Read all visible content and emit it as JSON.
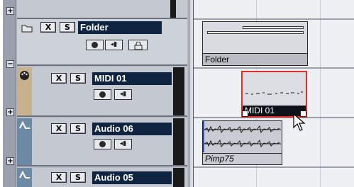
{
  "tracks": [
    {
      "type": "folder",
      "name": "Folder",
      "mute_label": "X",
      "solo_label": "S"
    },
    {
      "type": "midi",
      "name": "MIDI 01",
      "mute_label": "X",
      "solo_label": "S"
    },
    {
      "type": "audio",
      "name": "Audio 06",
      "mute_label": "X",
      "solo_label": "S"
    },
    {
      "type": "audio",
      "name": "Audio 05",
      "mute_label": "X",
      "solo_label": "S"
    }
  ],
  "expand_signs": {
    "plus": "+",
    "minus": "−"
  },
  "parts": {
    "folder_part": "Folder",
    "midi_part": "MIDI 01",
    "audio_part": "Pimp75"
  },
  "colors": {
    "midi_part_selected_border": "#e0302c",
    "track_name_bg": "#0f2440",
    "audio_part_bg": "#c9ccd2",
    "folder_part_bg": "#b9bcc3"
  }
}
